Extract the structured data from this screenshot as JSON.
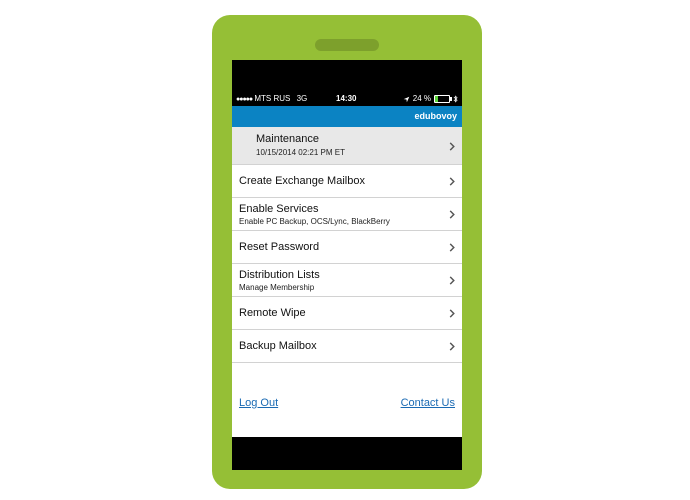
{
  "status_bar": {
    "signal": "●●●●●",
    "carrier": "MTS RUS",
    "network": "3G",
    "time": "14:30",
    "battery_text": "24 %",
    "battery_level": 0.24,
    "battery_color": "#5cd43a"
  },
  "header": {
    "username": "edubovoy"
  },
  "menu": {
    "items": [
      {
        "title": "Maintenance",
        "subtitle": "10/15/2014 02:21 PM ET"
      },
      {
        "title": "Create Exchange Mailbox"
      },
      {
        "title": "Enable Services",
        "subtitle": "Enable PC Backup, OCS/Lync, BlackBerry"
      },
      {
        "title": "Reset Password"
      },
      {
        "title": "Distribution Lists",
        "subtitle": "Manage Membership"
      },
      {
        "title": "Remote Wipe"
      },
      {
        "title": "Backup Mailbox"
      }
    ]
  },
  "footer": {
    "logout": "Log Out",
    "contact": "Contact Us"
  },
  "colors": {
    "phone_body": "#95bf36",
    "header_bar": "#0b83c3",
    "link": "#1a6ab3"
  },
  "icons": {
    "chevron": "chevron-right-icon",
    "location": "location-arrow-icon",
    "bluetooth": "bluetooth-icon"
  }
}
